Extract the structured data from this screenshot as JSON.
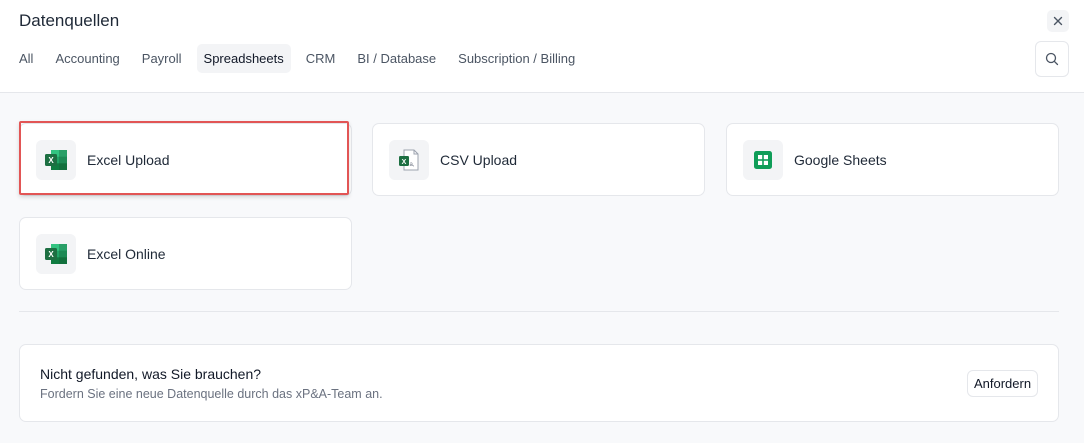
{
  "dialog": {
    "title": "Datenquellen",
    "close_icon": "close-icon",
    "search_icon": "search-icon"
  },
  "tabs": [
    {
      "label": "All",
      "active": false
    },
    {
      "label": "Accounting",
      "active": false
    },
    {
      "label": "Payroll",
      "active": false
    },
    {
      "label": "Spreadsheets",
      "active": true
    },
    {
      "label": "CRM",
      "active": false
    },
    {
      "label": "BI / Database",
      "active": false
    },
    {
      "label": "Subscription / Billing",
      "active": false
    }
  ],
  "sources": [
    {
      "label": "Excel Upload",
      "icon": "excel-icon",
      "highlighted": true
    },
    {
      "label": "CSV Upload",
      "icon": "csv-icon",
      "highlighted": false
    },
    {
      "label": "Google Sheets",
      "icon": "google-sheets-icon",
      "highlighted": false
    },
    {
      "label": "Excel Online",
      "icon": "excel-icon",
      "highlighted": false
    }
  ],
  "request": {
    "title": "Nicht gefunden, was Sie brauchen?",
    "subtitle": "Fordern Sie eine neue Datenquelle durch das xP&A-Team an.",
    "button_label": "Anfordern"
  },
  "colors": {
    "highlight": "#e25555",
    "excel_green": "#1d6f42",
    "sheets_green": "#0f9d58"
  }
}
